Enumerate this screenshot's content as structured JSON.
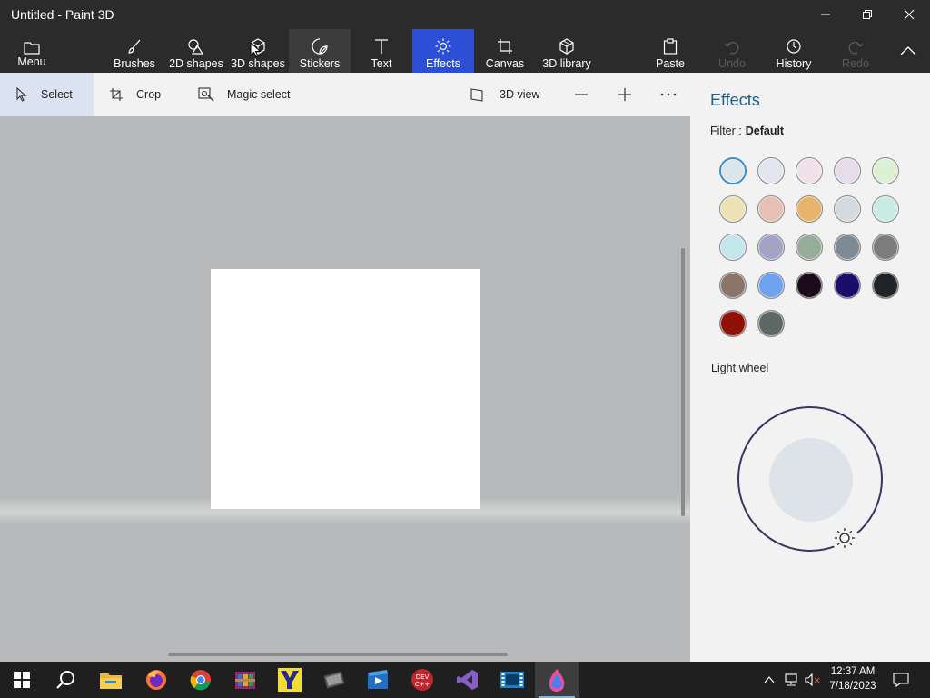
{
  "window": {
    "title": "Untitled - Paint 3D"
  },
  "ribbon": {
    "menu": "Menu",
    "brushes": "Brushes",
    "shapes2d": "2D shapes",
    "shapes3d": "3D shapes",
    "stickers": "Stickers",
    "text": "Text",
    "effects": "Effects",
    "canvas": "Canvas",
    "library3d": "3D library",
    "paste": "Paste",
    "undo": "Undo",
    "history": "History",
    "redo": "Redo",
    "active_tab": "Effects",
    "accent_color": "#2d4fd6"
  },
  "toolbar": {
    "select": "Select",
    "crop": "Crop",
    "magic_select": "Magic select",
    "view3d": "3D view"
  },
  "effects_panel": {
    "title": "Effects",
    "filter_label": "Filter :",
    "filter_value": "Default",
    "selected_index": 0,
    "swatches": [
      "#dbe5ec",
      "#e4e6ef",
      "#f3e1ea",
      "#e7dcec",
      "#dcf0d6",
      "#ece2b5",
      "#e7c0b4",
      "#e7b46c",
      "#d4dadd",
      "#c9ebe4",
      "#c3e6ea",
      "#a3a3c3",
      "#95ad9a",
      "#7e8b97",
      "#7c7c7c",
      "#8b7569",
      "#6ea2ef",
      "#1b0b1c",
      "#1b0e6a",
      "#1f2428",
      "#8f1108",
      "#5f6862"
    ],
    "light_wheel_label": "Light wheel"
  },
  "taskbar": {
    "apps": [
      "start-icon",
      "search-icon",
      "file-explorer-icon",
      "firefox-icon",
      "chrome-icon",
      "winrar-icon",
      "app-y-icon",
      "video-editor-icon",
      "movie-maker-icon",
      "devcpp-icon",
      "visual-studio-icon",
      "film-app-icon",
      "paint3d-icon"
    ],
    "time": "12:37 AM",
    "date": "7/18/2023"
  }
}
